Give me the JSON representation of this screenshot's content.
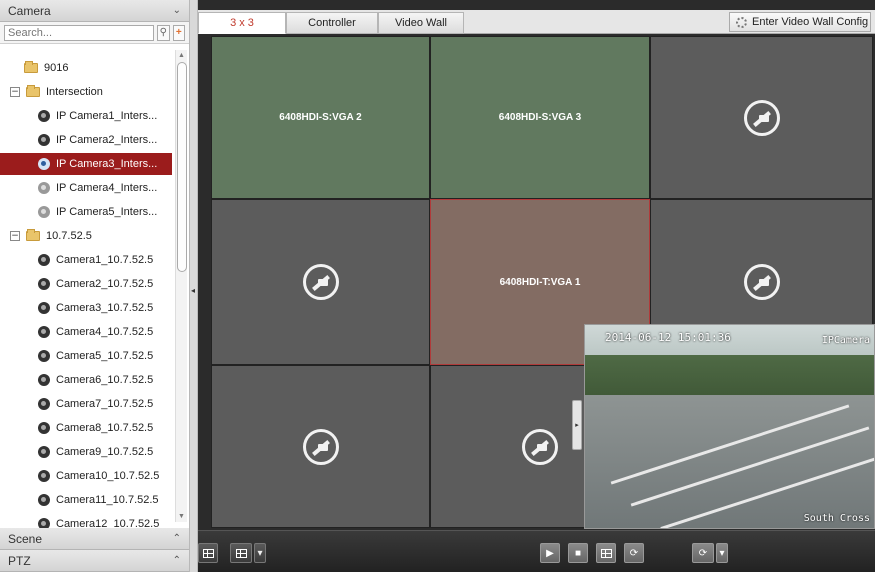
{
  "left_panel": {
    "camera_header": "Camera",
    "search": {
      "placeholder": "Search..."
    },
    "tree": [
      {
        "label": "9016",
        "type": "folder",
        "indent": 1
      },
      {
        "label": "Intersection",
        "type": "folder",
        "expander": "−",
        "indent": 0
      },
      {
        "label": "IP Camera1_Inters...",
        "type": "camera",
        "indent": 2
      },
      {
        "label": "IP Camera2_Inters...",
        "type": "camera",
        "indent": 2
      },
      {
        "label": "IP Camera3_Inters...",
        "type": "camera-selected",
        "indent": 2,
        "selected": true
      },
      {
        "label": "IP Camera4_Inters...",
        "type": "camera-offline",
        "indent": 2
      },
      {
        "label": "IP Camera5_Inters...",
        "type": "camera-offline",
        "indent": 2
      },
      {
        "label": "10.7.52.5",
        "type": "folder",
        "expander": "−",
        "indent": 0
      },
      {
        "label": "Camera1_10.7.52.5",
        "type": "camera",
        "indent": 2
      },
      {
        "label": "Camera2_10.7.52.5",
        "type": "camera",
        "indent": 2
      },
      {
        "label": "Camera3_10.7.52.5",
        "type": "camera",
        "indent": 2
      },
      {
        "label": "Camera4_10.7.52.5",
        "type": "camera",
        "indent": 2
      },
      {
        "label": "Camera5_10.7.52.5",
        "type": "camera",
        "indent": 2
      },
      {
        "label": "Camera6_10.7.52.5",
        "type": "camera",
        "indent": 2
      },
      {
        "label": "Camera7_10.7.52.5",
        "type": "camera",
        "indent": 2
      },
      {
        "label": "Camera8_10.7.52.5",
        "type": "camera",
        "indent": 2
      },
      {
        "label": "Camera9_10.7.52.5",
        "type": "camera",
        "indent": 2
      },
      {
        "label": "Camera10_10.7.52.5",
        "type": "camera",
        "indent": 2
      },
      {
        "label": "Camera11_10.7.52.5",
        "type": "camera",
        "indent": 2
      },
      {
        "label": "Camera12_10.7.52.5",
        "type": "camera",
        "indent": 2
      }
    ],
    "scene_header": "Scene",
    "ptz_header": "PTZ"
  },
  "tabs": [
    {
      "label": "3 x 3",
      "active": true
    },
    {
      "label": "Controller",
      "active": false
    },
    {
      "label": "Video Wall",
      "active": false
    }
  ],
  "enter_config_label": "Enter Video Wall Config",
  "grid_cells": [
    {
      "label": "6408HDI-S:VGA 2",
      "state": "green"
    },
    {
      "label": "6408HDI-S:VGA 3",
      "state": "green"
    },
    {
      "label": "",
      "state": "nosignal"
    },
    {
      "label": "",
      "state": "nosignal"
    },
    {
      "label": "6408HDI-T:VGA 1",
      "state": "brown"
    },
    {
      "label": "",
      "state": "nosignal"
    },
    {
      "label": "",
      "state": "nosignal"
    },
    {
      "label": "",
      "state": "nosignal"
    },
    {
      "label": "",
      "state": "preview"
    }
  ],
  "preview": {
    "timestamp": "2014-06-12 15:01:36",
    "camera_name": "IPCamera",
    "location": "South Cross"
  },
  "icons": {
    "search": "⚲",
    "add": "+",
    "chevron_down": "⌄",
    "chevron_up": "⌃",
    "collapse": "◂",
    "dropdown": "▾",
    "play": "▶",
    "stop": "■",
    "loop": "⟳"
  }
}
